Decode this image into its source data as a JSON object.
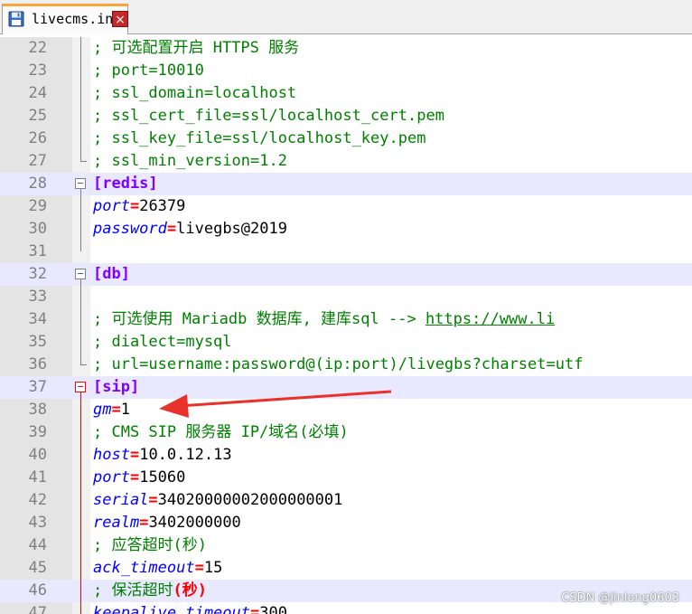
{
  "tab": {
    "filename": "livecms.ini",
    "close_glyph": "×",
    "icon": "floppy-disk-icon",
    "close_icon": "close-icon"
  },
  "colors": {
    "comment": "#008000",
    "section": "#8000ff",
    "key": "#0000ff",
    "operator": "#ff0000",
    "value": "#000000",
    "current_line": "#e8e8ff",
    "annotation_arrow": "#e8322c"
  },
  "lines": [
    {
      "n": "22",
      "parts": [
        {
          "t": "; 可选配置开启 HTTPS 服务",
          "c": "comment"
        }
      ]
    },
    {
      "n": "23",
      "parts": [
        {
          "t": "; port=10010",
          "c": "comment"
        }
      ]
    },
    {
      "n": "24",
      "parts": [
        {
          "t": "; ssl_domain=localhost",
          "c": "comment"
        }
      ]
    },
    {
      "n": "25",
      "parts": [
        {
          "t": "; ssl_cert_file=ssl/localhost_cert.pem",
          "c": "comment"
        }
      ]
    },
    {
      "n": "26",
      "parts": [
        {
          "t": "; ssl_key_file=ssl/localhost_key.pem",
          "c": "comment"
        }
      ]
    },
    {
      "n": "27",
      "parts": [
        {
          "t": "; ssl_min_version=1.2",
          "c": "comment"
        }
      ]
    },
    {
      "n": "28",
      "parts": [
        {
          "t": "[redis]",
          "c": "section"
        }
      ]
    },
    {
      "n": "29",
      "parts": [
        {
          "t": "port",
          "c": "key"
        },
        {
          "t": "=",
          "c": "eq"
        },
        {
          "t": "26379",
          "c": "val"
        }
      ]
    },
    {
      "n": "30",
      "parts": [
        {
          "t": "password",
          "c": "key"
        },
        {
          "t": "=",
          "c": "eq"
        },
        {
          "t": "livegbs@2019",
          "c": "val"
        }
      ]
    },
    {
      "n": "31",
      "parts": []
    },
    {
      "n": "32",
      "parts": [
        {
          "t": "[db]",
          "c": "section"
        }
      ]
    },
    {
      "n": "33",
      "parts": []
    },
    {
      "n": "34",
      "parts": [
        {
          "t": "; 可选使用 Mariadb 数据库, 建库sql --> ",
          "c": "comment"
        },
        {
          "t": "https://www.li",
          "c": "url"
        }
      ]
    },
    {
      "n": "35",
      "parts": [
        {
          "t": "; dialect=mysql",
          "c": "comment"
        }
      ]
    },
    {
      "n": "36",
      "parts": [
        {
          "t": "; url=username:password@(ip:port)/livegbs?charset=utf",
          "c": "comment"
        }
      ]
    },
    {
      "n": "37",
      "parts": [
        {
          "t": "[sip]",
          "c": "section"
        }
      ]
    },
    {
      "n": "38",
      "parts": [
        {
          "t": "gm",
          "c": "key"
        },
        {
          "t": "=",
          "c": "eq"
        },
        {
          "t": "1",
          "c": "val"
        }
      ]
    },
    {
      "n": "39",
      "parts": [
        {
          "t": "; CMS SIP 服务器 IP/域名(必填)",
          "c": "comment"
        }
      ]
    },
    {
      "n": "40",
      "parts": [
        {
          "t": "host",
          "c": "key"
        },
        {
          "t": "=",
          "c": "eq"
        },
        {
          "t": "10.0.12.13",
          "c": "val"
        }
      ]
    },
    {
      "n": "41",
      "parts": [
        {
          "t": "port",
          "c": "key"
        },
        {
          "t": "=",
          "c": "eq"
        },
        {
          "t": "15060",
          "c": "val"
        }
      ]
    },
    {
      "n": "42",
      "parts": [
        {
          "t": "serial",
          "c": "key"
        },
        {
          "t": "=",
          "c": "eq"
        },
        {
          "t": "34020000002000000001",
          "c": "val"
        }
      ]
    },
    {
      "n": "43",
      "parts": [
        {
          "t": "realm",
          "c": "key"
        },
        {
          "t": "=",
          "c": "eq"
        },
        {
          "t": "3402000000",
          "c": "val"
        }
      ]
    },
    {
      "n": "44",
      "parts": [
        {
          "t": "; 应答超时(秒)",
          "c": "comment"
        }
      ]
    },
    {
      "n": "45",
      "parts": [
        {
          "t": "ack_timeout",
          "c": "key"
        },
        {
          "t": "=",
          "c": "eq"
        },
        {
          "t": "15",
          "c": "val"
        }
      ]
    },
    {
      "n": "46",
      "parts": [
        {
          "t": "; 保活超时",
          "c": "comment"
        },
        {
          "t": "(秒)",
          "c": "eq"
        }
      ]
    },
    {
      "n": "47",
      "parts": [
        {
          "t": "keepalive_timeout",
          "c": "key"
        },
        {
          "t": "=",
          "c": "eq"
        },
        {
          "t": "300",
          "c": "val"
        }
      ]
    }
  ],
  "highlighted_lines": [
    "28",
    "32",
    "37",
    "46"
  ],
  "watermark": "CSDN @jinlong0603"
}
